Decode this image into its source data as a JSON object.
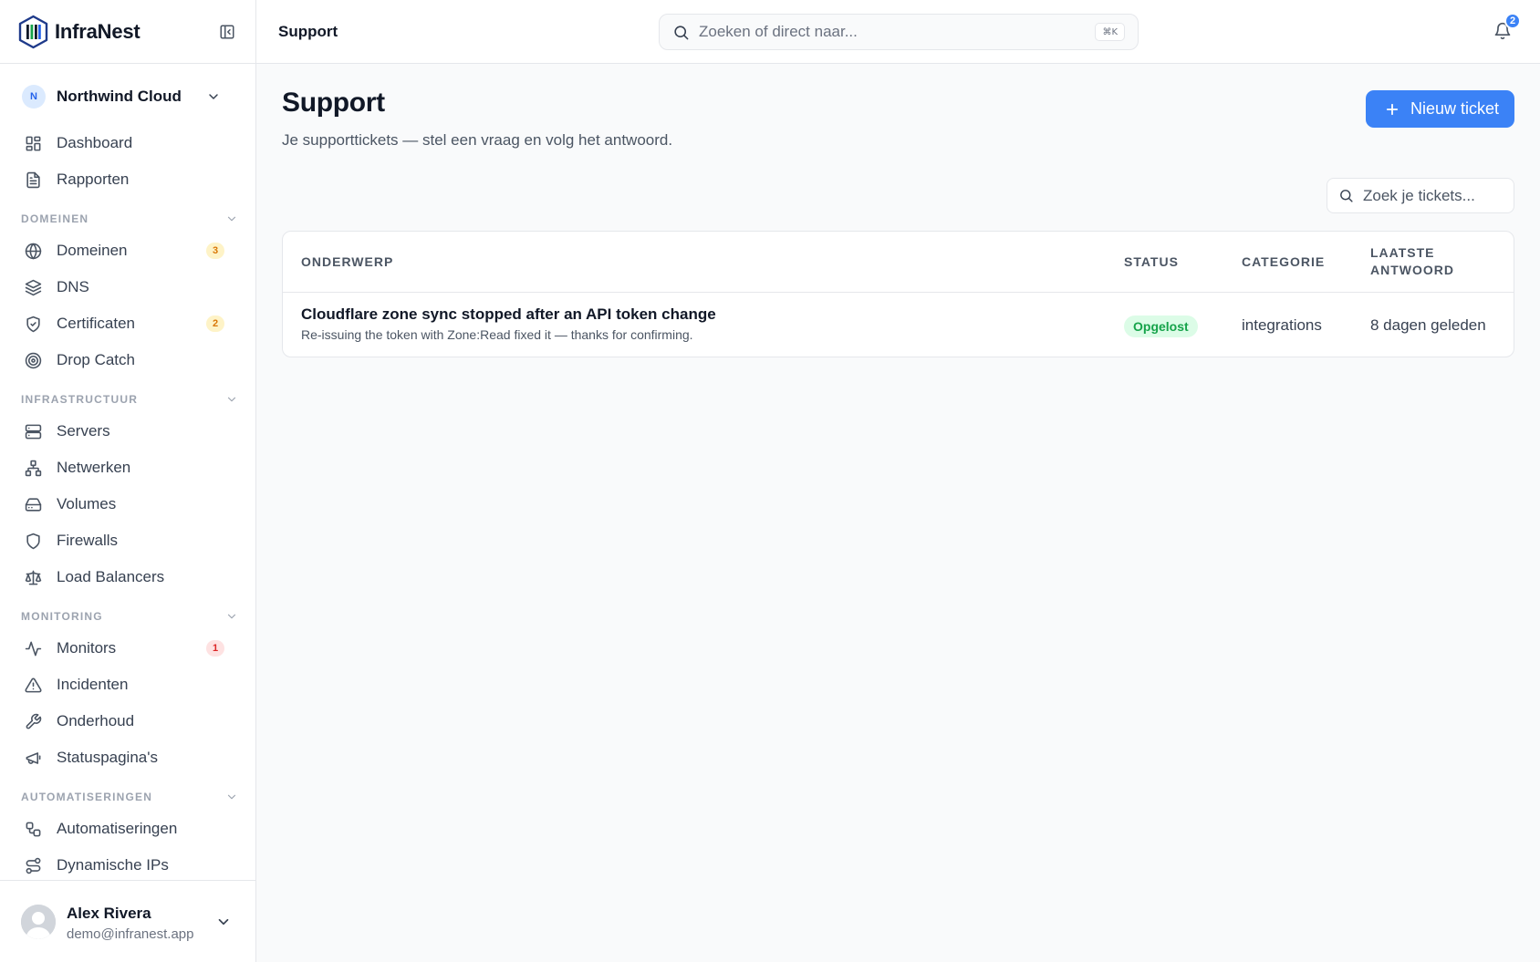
{
  "app": {
    "name": "InfraNest"
  },
  "org": {
    "initial": "N",
    "name": "Northwind Cloud"
  },
  "nav": {
    "top": [
      {
        "label": "Dashboard",
        "icon": "dashboard-icon"
      },
      {
        "label": "Rapporten",
        "icon": "report-icon"
      }
    ],
    "sections": [
      {
        "title": "DOMEINEN",
        "items": [
          {
            "label": "Domeinen",
            "icon": "globe-icon",
            "badge": "3"
          },
          {
            "label": "DNS",
            "icon": "layers-icon"
          },
          {
            "label": "Certificaten",
            "icon": "shield-check-icon",
            "badge": "2"
          },
          {
            "label": "Drop Catch",
            "icon": "target-icon"
          }
        ]
      },
      {
        "title": "INFRASTRUCTUUR",
        "items": [
          {
            "label": "Servers",
            "icon": "server-icon"
          },
          {
            "label": "Netwerken",
            "icon": "network-icon"
          },
          {
            "label": "Volumes",
            "icon": "hard-drive-icon"
          },
          {
            "label": "Firewalls",
            "icon": "shield-icon"
          },
          {
            "label": "Load Balancers",
            "icon": "scale-icon"
          }
        ]
      },
      {
        "title": "MONITORING",
        "items": [
          {
            "label": "Monitors",
            "icon": "activity-icon",
            "badge": "1"
          },
          {
            "label": "Incidenten",
            "icon": "alert-triangle-icon"
          },
          {
            "label": "Onderhoud",
            "icon": "wrench-icon"
          },
          {
            "label": "Statuspagina's",
            "icon": "megaphone-icon"
          }
        ]
      },
      {
        "title": "AUTOMATISERINGEN",
        "items": [
          {
            "label": "Automatiseringen",
            "icon": "workflow-icon"
          },
          {
            "label": "Dynamische IPs",
            "icon": "route-icon"
          }
        ]
      }
    ]
  },
  "user": {
    "name": "Alex Rivera",
    "email": "demo@infranest.app"
  },
  "topbar": {
    "breadcrumb": "Support",
    "search_placeholder": "Zoeken of direct naar...",
    "shortcut": "⌘K",
    "notifications": "2"
  },
  "page": {
    "title": "Support",
    "subtitle": "Je supporttickets — stel een vraag en volg het antwoord.",
    "new_button": "Nieuw ticket",
    "search_placeholder": "Zoek je tickets..."
  },
  "table": {
    "columns": {
      "subject": "ONDERWERP",
      "status": "STATUS",
      "category": "CATEGORIE",
      "last_reply_1": "LAATSTE",
      "last_reply_2": "ANTWOORD"
    },
    "rows": [
      {
        "subject": "Cloudflare zone sync stopped after an API token change",
        "excerpt": "Re-issuing the token with Zone:Read fixed it — thanks for confirming.",
        "status": "Opgelost",
        "category": "integrations",
        "last_reply": "8 dagen geleden"
      }
    ]
  },
  "colors": {
    "accent": "#3b82f6",
    "status_resolved_bg": "#dcfce7",
    "status_resolved_fg": "#16a34a",
    "badge_amber": "#d97706",
    "badge_red": "#dc2626"
  }
}
